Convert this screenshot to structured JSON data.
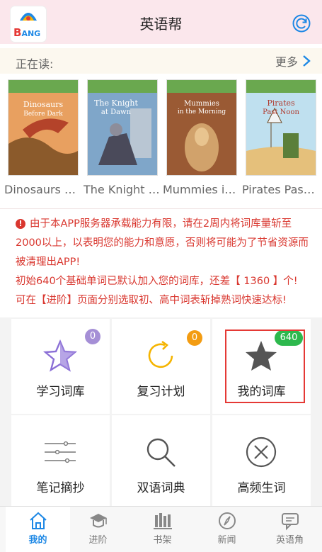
{
  "header": {
    "title": "英语帮",
    "logo_text": "B",
    "logo_text_small": "ANG"
  },
  "reading": {
    "label": "正在读:",
    "more": "更多"
  },
  "books": [
    {
      "title": "Dinosaurs Before Dark",
      "cover_title": "Dinosaurs Before Dark",
      "cover_color": "#d96b4a"
    },
    {
      "title": "The Knight at Dawn",
      "cover_title": "The Knight at Dawn",
      "cover_color": "#5a7fa8"
    },
    {
      "title": "Mummies in the Morning",
      "cover_title": "Mummies in the Morning",
      "cover_color": "#a5673d"
    },
    {
      "title": "Pirates Past Noon",
      "cover_title": "Pirates Past Noon",
      "cover_color": "#6fb3d6"
    }
  ],
  "notice": {
    "line1": "由于本APP服务器承载能力有限，请在2周内将词库量斩至2000以上，以表明您的能力和意愿，否则将可能为了节省资源而被清理出APP!",
    "line2": "初始640个基础单词已默认加入您的词库，还差【 1360 】个!",
    "line3": "可在【进阶】页面分别选取初、高中词表斩掉熟词快速达标!"
  },
  "grid": [
    {
      "label": "学习词库",
      "badge": "0",
      "badge_color": "#a58fd6",
      "icon": "star-outline-icon"
    },
    {
      "label": "复习计划",
      "badge": "0",
      "badge_color": "#f39c12",
      "icon": "refresh-circle-icon"
    },
    {
      "label": "我的词库",
      "badge": "640",
      "badge_color": "#2db84d",
      "icon": "star-filled-icon"
    },
    {
      "label": "笔记摘抄",
      "icon": "notes-lines-icon"
    },
    {
      "label": "双语词典",
      "icon": "magnifier-icon"
    },
    {
      "label": "高频生词",
      "icon": "x-circle-icon"
    }
  ],
  "tabs": [
    {
      "label": "我的",
      "icon": "home-icon",
      "active": true
    },
    {
      "label": "进阶",
      "icon": "graduation-cap-icon"
    },
    {
      "label": "书架",
      "icon": "bookshelf-icon"
    },
    {
      "label": "新闻",
      "icon": "compass-icon"
    },
    {
      "label": "英语角",
      "icon": "chat-bubbles-icon"
    }
  ],
  "colors": {
    "header_bg": "#fbe7ec",
    "notice_text": "#d9372f",
    "accent_blue": "#1e88e5"
  }
}
